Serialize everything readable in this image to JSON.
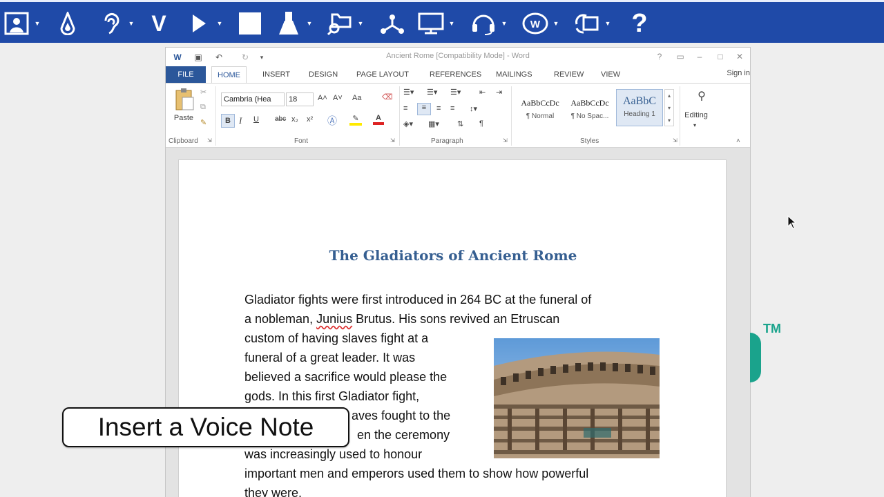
{
  "toolbar": {
    "items": [
      {
        "icon": "picture-icon"
      },
      {
        "icon": "ink-drop-icon"
      },
      {
        "icon": "ear-icon"
      },
      {
        "icon": "letter-v-icon",
        "glyph": "V"
      },
      {
        "icon": "play-icon"
      },
      {
        "icon": "stop-icon"
      },
      {
        "icon": "flask-icon"
      },
      {
        "icon": "folder-search-icon"
      },
      {
        "icon": "network-icon"
      },
      {
        "icon": "monitor-icon"
      },
      {
        "icon": "headset-icon"
      },
      {
        "icon": "web-circle-icon"
      },
      {
        "icon": "image-sync-icon"
      },
      {
        "icon": "help-icon",
        "glyph": "?"
      }
    ]
  },
  "word": {
    "title": "Ancient Rome [Compatibility Mode] - Word",
    "tabs": [
      "FILE",
      "HOME",
      "INSERT",
      "DESIGN",
      "PAGE LAYOUT",
      "REFERENCES",
      "MAILINGS",
      "REVIEW",
      "VIEW"
    ],
    "active_tab": "HOME",
    "sign_in": "Sign in",
    "ribbon": {
      "paste_label": "Paste",
      "clipboard_label": "Clipboard",
      "font_name": "Cambria (Hea",
      "font_size": "18",
      "font_label": "Font",
      "paragraph_label": "Paragraph",
      "styles_label": "Styles",
      "editing_label": "Editing",
      "styles": [
        {
          "sample": "AaBbCcDc",
          "name": "¶ Normal"
        },
        {
          "sample": "AaBbCcDc",
          "name": "¶ No Spac..."
        },
        {
          "sample": "AaBbC",
          "name": "Heading 1"
        }
      ],
      "bold": "B",
      "italic": "I",
      "underline": "U",
      "strike": "abc",
      "subscript": "x₂",
      "superscript": "x²",
      "change_case": "Aa"
    },
    "document": {
      "heading": "The Gladiators of Ancient Rome",
      "lines": [
        "Gladiator fights were first introduced in 264 BC at the funeral of",
        "a nobleman,",
        "Junius",
        "Brutus. His sons revived an Etruscan",
        "custom of having slaves fight at a",
        "funeral of a great leader. It was",
        "believed a sacrifice would please the",
        "gods. In this first Gladiator fight,",
        "aves fought to the",
        "en the ceremony",
        "was increasingly used to honour",
        "important men and emperors used them to show how powerful",
        "they were."
      ]
    }
  },
  "callout": {
    "text": "Insert a Voice Note"
  },
  "brand": {
    "tm": "TM",
    "teal": "#1aa38c"
  }
}
